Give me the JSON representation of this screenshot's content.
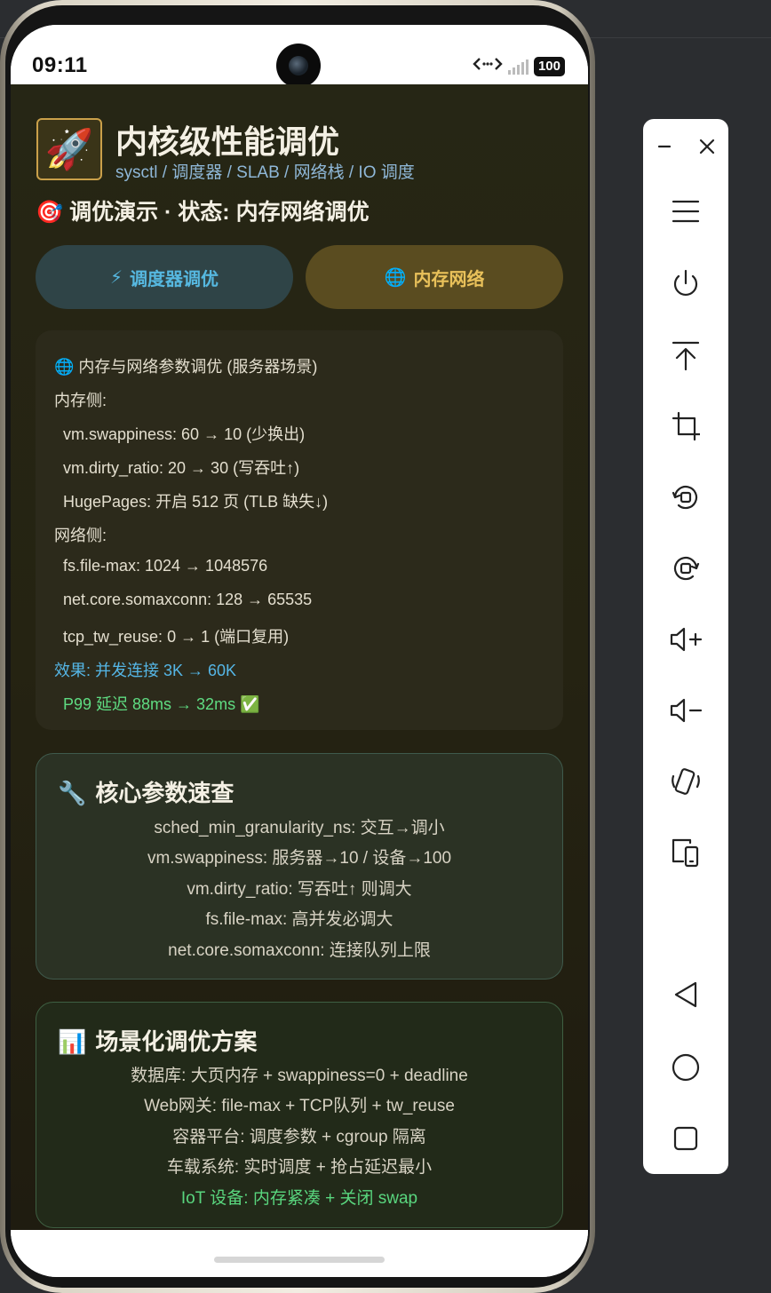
{
  "status_bar": {
    "time": "09:11",
    "battery": "100",
    "network_icon": "data-transfer-icon",
    "signal_icon": "signal-bars-icon"
  },
  "app": {
    "header_icon": "rocket-icon",
    "header_icon_char": "🚀",
    "title": "内核级性能调优",
    "subtitle": "sysctl / 调度器 / SLAB / 网络栈 / IO 调度",
    "status_icon": "🎯",
    "status_text": "调优演示 · 状态: 内存网络调优",
    "tabs": [
      {
        "icon": "⚡",
        "label": "调度器调优",
        "selected": false
      },
      {
        "icon": "🌐",
        "label": "内存网络",
        "selected": true
      }
    ],
    "output_lines": [
      "🌐 内存与网络参数调优 (服务器场景)",
      "内存侧:",
      "  vm.swappiness: 60 → 10 (少换出)",
      "  vm.dirty_ratio: 20 → 30 (写吞吐↑)",
      "  HugePages: 开启 512 页 (TLB 缺失↓)",
      "网络侧:",
      "  fs.file-max: 1024 → 1048576",
      "  net.core.somaxconn: 128 → 65535",
      "  tcp_tw_reuse: 0 → 1 (端口复用)",
      "效果: 并发连接 3K → 60K",
      "  P99 延迟 88ms → 32ms ✅"
    ],
    "params_card": {
      "icon": "🔧",
      "title": "核心参数速查",
      "rows": [
        "sched_min_granularity_ns: 交互→调小",
        "vm.swappiness: 服务器→10 / 设备→100",
        "vm.dirty_ratio: 写吞吐↑ 则调大",
        "fs.file-max: 高并发必调大",
        "net.core.somaxconn: 连接队列上限"
      ]
    },
    "scenario_card": {
      "icon": "📊",
      "title": "场景化调优方案",
      "rows": [
        "数据库: 大页内存 + swappiness=0 + deadline",
        "Web网关: file-max + TCP队列 + tw_reuse",
        "容器平台: 调度参数 + cgroup 隔离",
        "车载系统: 实时调度 + 抢占延迟最小",
        "IoT 设备: 内存紧凑 + 关闭 swap"
      ]
    }
  },
  "colors": {
    "accent_blue": "#55b6e6",
    "accent_gold": "#e9c15a",
    "accent_green": "#5fdc82"
  },
  "emulator_toolbar": {
    "items": [
      "minimize-icon",
      "close-icon",
      "menu-icon",
      "power-icon",
      "pin-top-icon",
      "crop-icon",
      "rotate-left-icon",
      "rotate-right-icon",
      "volume-up-icon",
      "volume-down-icon",
      "shake-icon",
      "fold-icon",
      "back-icon",
      "home-icon",
      "overview-icon"
    ]
  }
}
